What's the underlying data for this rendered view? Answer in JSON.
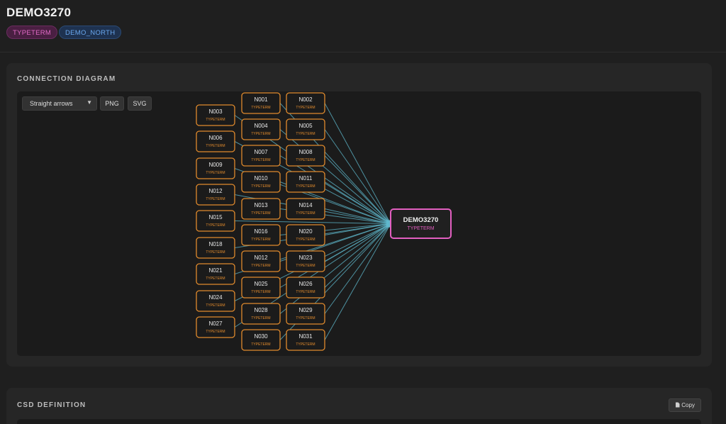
{
  "header": {
    "title": "DEMO3270",
    "badges": [
      "TYPETERM",
      "DEMO_NORTH"
    ]
  },
  "connection_diagram": {
    "title": "CONNECTION DIAGRAM",
    "arrow_style": "Straight arrows",
    "export_png_label": "PNG",
    "export_svg_label": "SVG",
    "target": {
      "name": "DEMO3270",
      "type": "TYPETERM"
    },
    "nodes": [
      {
        "name": "N001",
        "type": "TYPETERM",
        "col": 1,
        "row": 0
      },
      {
        "name": "N002",
        "type": "TYPETERM",
        "col": 2,
        "row": 0
      },
      {
        "name": "N003",
        "type": "TYPETERM",
        "col": 0,
        "row": 0
      },
      {
        "name": "N004",
        "type": "TYPETERM",
        "col": 1,
        "row": 1
      },
      {
        "name": "N005",
        "type": "TYPETERM",
        "col": 2,
        "row": 1
      },
      {
        "name": "N006",
        "type": "TYPETERM",
        "col": 0,
        "row": 1
      },
      {
        "name": "N007",
        "type": "TYPETERM",
        "col": 1,
        "row": 2
      },
      {
        "name": "N008",
        "type": "TYPETERM",
        "col": 2,
        "row": 2
      },
      {
        "name": "N009",
        "type": "TYPETERM",
        "col": 0,
        "row": 2
      },
      {
        "name": "N010",
        "type": "TYPETERM",
        "col": 1,
        "row": 3
      },
      {
        "name": "N011",
        "type": "TYPETERM",
        "col": 2,
        "row": 3
      },
      {
        "name": "N012",
        "type": "TYPETERM",
        "col": 0,
        "row": 3
      },
      {
        "name": "N013",
        "type": "TYPETERM",
        "col": 1,
        "row": 4
      },
      {
        "name": "N014",
        "type": "TYPETERM",
        "col": 2,
        "row": 4
      },
      {
        "name": "N015",
        "type": "TYPETERM",
        "col": 0,
        "row": 4
      },
      {
        "name": "N016",
        "type": "TYPETERM",
        "col": 1,
        "row": 5
      },
      {
        "name": "N020",
        "type": "TYPETERM",
        "col": 2,
        "row": 5
      },
      {
        "name": "N018",
        "type": "TYPETERM",
        "col": 0,
        "row": 5
      },
      {
        "name": "N012",
        "type": "TYPETERM",
        "col": 1,
        "row": 6
      },
      {
        "name": "N023",
        "type": "TYPETERM",
        "col": 2,
        "row": 6
      },
      {
        "name": "N021",
        "type": "TYPETERM",
        "col": 0,
        "row": 6
      },
      {
        "name": "N025",
        "type": "TYPETERM",
        "col": 1,
        "row": 7
      },
      {
        "name": "N026",
        "type": "TYPETERM",
        "col": 2,
        "row": 7
      },
      {
        "name": "N024",
        "type": "TYPETERM",
        "col": 0,
        "row": 7
      },
      {
        "name": "N028",
        "type": "TYPETERM",
        "col": 1,
        "row": 8
      },
      {
        "name": "N029",
        "type": "TYPETERM",
        "col": 2,
        "row": 8
      },
      {
        "name": "N027",
        "type": "TYPETERM",
        "col": 0,
        "row": 8
      },
      {
        "name": "N030",
        "type": "TYPETERM",
        "col": 1,
        "row": 9
      },
      {
        "name": "N031",
        "type": "TYPETERM",
        "col": 2,
        "row": 9
      }
    ],
    "colors": {
      "node_border": "#e08a2c",
      "node_type_text": "#e08a2c",
      "edge": "#5fb8cc",
      "target_border": "#e25fc0",
      "target_type_text": "#e25fc0"
    }
  },
  "csd_definition": {
    "title": "CSD DEFINITION",
    "copy_label": "Copy",
    "copy_icon": "document-icon"
  }
}
